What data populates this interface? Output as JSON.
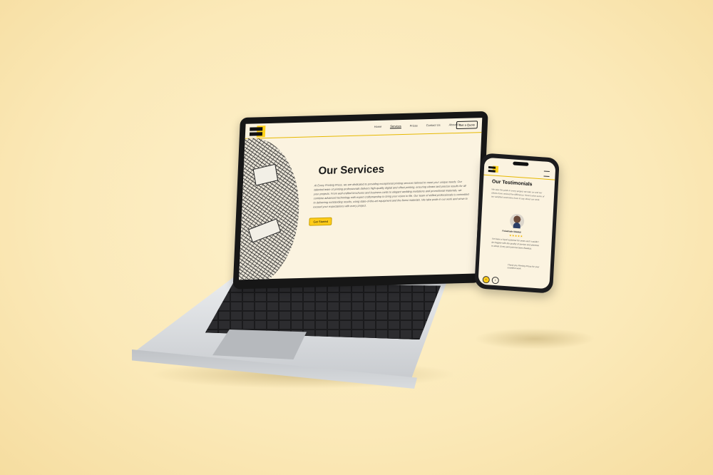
{
  "laptop_site": {
    "nav": {
      "links": [
        "Home",
        "Services",
        "Prices",
        "Contact Us",
        "About Us"
      ],
      "active": "Services",
      "cta": "Get a Quote"
    },
    "hero": {
      "title": "Our Services",
      "body": "At Every Printing Press, we are dedicated to providing exceptional printing services tailored to meet your unique needs. Our talented team of printing professionals delivers high-quality digital and offset printing, ensuring vibrant and precise results for all your projects. From well-crafted brochures and business cards to elegant wedding invitations and promotional materials, we combine advanced technology with expert craftsmanship to bring your vision to life. Our team of skilled professionals is committed to delivering outstanding results, using state-of-the-art equipment and the finest materials. We take pride in our work and strive to exceed your expectations with every project.",
      "cta": "Get Started"
    }
  },
  "phone_site": {
    "title": "Our Testimonials",
    "intro": "We take the pride in every project we take on and our clients have noticed the difference. Here's what some of our satisfied customers have to say about our work.",
    "testimonial": {
      "name": "Folashade Adedeji",
      "rating": "★★★★★",
      "quote": "I've been a loyal customer for years and I couldn't be happier with the quality of service and attention to detail. Every print job has been flawless.",
      "signature": "Thank you Printing Press for your excellent work"
    },
    "controls": {
      "prev": "‹",
      "next": "›"
    }
  },
  "colors": {
    "accent": "#ffcc1a",
    "background": "#fbe9b8",
    "device": "#161616"
  }
}
